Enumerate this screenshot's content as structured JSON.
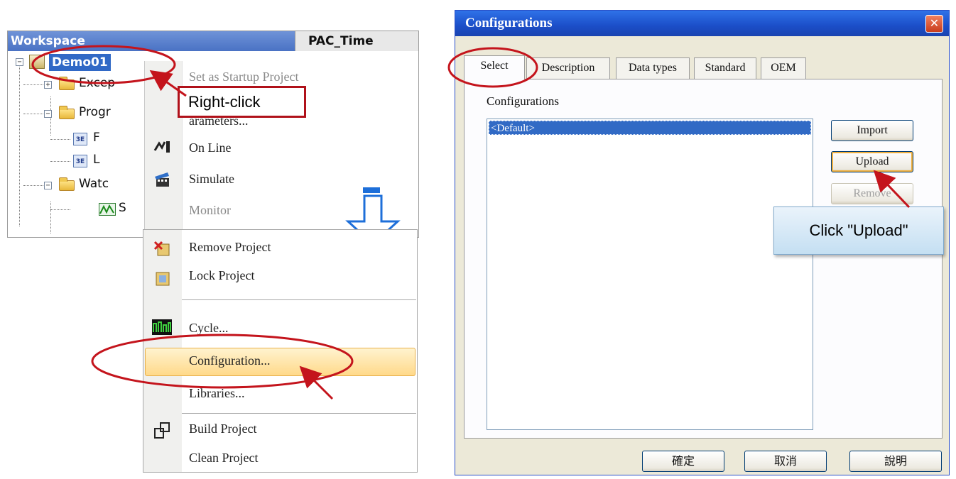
{
  "workspace": {
    "header_title": "Workspace",
    "column_header": "PAC_Time",
    "project_name": "Demo01",
    "tree_items": [
      {
        "label": "Excep"
      },
      {
        "label": "Progr"
      },
      {
        "label": "F"
      },
      {
        "label": "L"
      },
      {
        "label": "Watc"
      },
      {
        "label": "S"
      }
    ]
  },
  "context_menu_top": {
    "items": [
      {
        "label": "Set as Startup Project",
        "disabled": true
      },
      {
        "label": "arameters...",
        "disabled": false
      },
      {
        "label": "On Line",
        "disabled": false
      },
      {
        "label": "Simulate",
        "disabled": false
      },
      {
        "label": "Monitor",
        "disabled": true
      }
    ]
  },
  "context_menu_bottom": {
    "items": [
      {
        "label": "Remove Project"
      },
      {
        "label": "Lock Project"
      },
      {
        "label": "Cycle..."
      },
      {
        "label": "Configuration..."
      },
      {
        "label": "Libraries..."
      },
      {
        "label": "Build Project"
      },
      {
        "label": "Clean Project"
      }
    ],
    "highlighted": "Configuration..."
  },
  "callouts": {
    "right_click": "Right-click",
    "click_upload": "Click  \"Upload\""
  },
  "dialog": {
    "title": "Configurations",
    "close_glyph": "✕",
    "tabs": [
      "Select",
      "Description",
      "Data types",
      "Standard",
      "OEM"
    ],
    "active_tab": "Select",
    "list_label": "Configurations",
    "list_items": [
      "<Default>"
    ],
    "selected_item": "<Default>",
    "side_buttons": {
      "import": "Import",
      "upload": "Upload",
      "remove": "Remove"
    },
    "footer_buttons": {
      "ok": "確定",
      "cancel": "取消",
      "help": "說明"
    }
  },
  "colors": {
    "highlight_red": "#c4141c",
    "title_blue": "#1b4ec8",
    "selection_blue": "#316ac5",
    "arrow_blue": "#1e6fd9"
  }
}
